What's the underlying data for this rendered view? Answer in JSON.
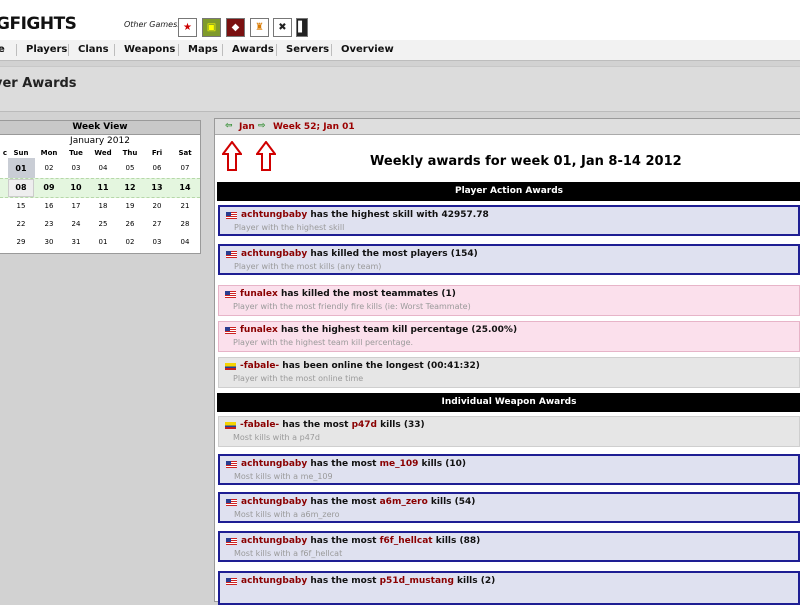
{
  "header": {
    "logo": "GFIGHTS",
    "other_games_label": "Other Games:",
    "game_icons": [
      "star-game-icon",
      "tank-game-icon",
      "red-game-icon",
      "helmet-game-icon",
      "soldier-game-icon",
      "figure-game-icon"
    ]
  },
  "nav": {
    "items": [
      "e",
      "Players",
      "Clans",
      "Weapons",
      "Maps",
      "Awards",
      "Servers",
      "Overview"
    ]
  },
  "page_title": "yer Awards",
  "calendar": {
    "title": "Week View",
    "month": "January 2012",
    "days": [
      "c",
      "Sun",
      "Mon",
      "Tue",
      "Wed",
      "Thu",
      "Fri",
      "Sat"
    ],
    "rows": [
      [
        "",
        "01",
        "02",
        "03",
        "04",
        "05",
        "06",
        "07"
      ],
      [
        "",
        "08",
        "09",
        "10",
        "11",
        "12",
        "13",
        "14"
      ],
      [
        "",
        "15",
        "16",
        "17",
        "18",
        "19",
        "20",
        "21"
      ],
      [
        "",
        "22",
        "23",
        "24",
        "25",
        "26",
        "27",
        "28"
      ],
      [
        "",
        "29",
        "30",
        "31",
        "01",
        "02",
        "03",
        "04"
      ]
    ]
  },
  "weeknav": {
    "prev_label": "Jan",
    "next_label": "Week 52; Jan 01"
  },
  "weekly_title": "Weekly awards for week 01, Jan 8-14 2012",
  "sections": {
    "player_actions": "Player Action Awards",
    "weapons": "Individual Weapon Awards"
  },
  "player_awards": [
    {
      "flag": "us",
      "player": "achtungbaby",
      "text": " has the highest skill with 42957.78",
      "sub": "Player with the highest skill"
    },
    {
      "flag": "us",
      "player": "achtungbaby",
      "text": " has killed the most players (154)",
      "sub": "Player with the most kills (any team)"
    },
    {
      "flag": "us",
      "player": "funalex",
      "text": " has killed the most teammates (1)",
      "sub": "Player with the most friendly fire kills (ie: Worst Teammate)"
    },
    {
      "flag": "us",
      "player": "funalex",
      "text": " has the highest team kill percentage (25.00%)",
      "sub": "Player with the highest team kill percentage."
    },
    {
      "flag": "co",
      "player": "-fabale-",
      "text": " has been online the longest (00:41:32)",
      "sub": "Player with the most online time"
    }
  ],
  "weapon_awards": [
    {
      "flag": "co",
      "player": "-fabale-",
      "pre": " has the most ",
      "weapon": "p47d",
      "post": " kills (33)",
      "sub": "Most kills with a p47d"
    },
    {
      "flag": "us",
      "player": "achtungbaby",
      "pre": " has the most ",
      "weapon": "me_109",
      "post": " kills (10)",
      "sub": "Most kills with a me_109"
    },
    {
      "flag": "us",
      "player": "achtungbaby",
      "pre": " has the most ",
      "weapon": "a6m_zero",
      "post": " kills (54)",
      "sub": "Most kills with a a6m_zero"
    },
    {
      "flag": "us",
      "player": "achtungbaby",
      "pre": " has the most ",
      "weapon": "f6f_hellcat",
      "post": " kills (88)",
      "sub": "Most kills with a f6f_hellcat"
    },
    {
      "flag": "us",
      "player": "achtungbaby",
      "pre": " has the most ",
      "weapon": "p51d_mustang",
      "post": " kills (2)",
      "sub": ""
    }
  ],
  "colors": {
    "player_link": "#8a0000",
    "award_border": "#1e1e93",
    "section_header": "#000000"
  }
}
